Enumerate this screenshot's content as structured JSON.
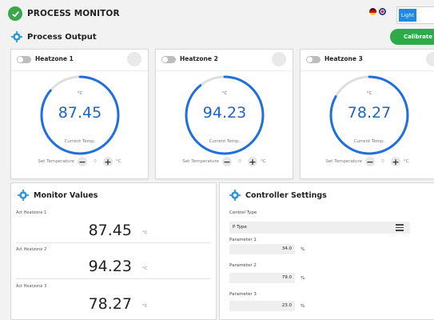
{
  "header": {
    "app_title": "PROCESS MONITOR",
    "section_title": "Process Output",
    "theme_light_label": "Light",
    "calibrate_label": "Calibrate",
    "flags": [
      "german-flag-icon",
      "uk-flag-icon"
    ]
  },
  "heatzones": [
    {
      "name": "Heatzone 1",
      "unit": "°C",
      "value": "87.45",
      "current_label": "Current Temp.",
      "set_label": "Set Temperature",
      "set_value": "0",
      "set_unit": "°C",
      "gauge_fraction": 0.86
    },
    {
      "name": "Heatzone 2",
      "unit": "°C",
      "value": "94.23",
      "current_label": "Current Temp.",
      "set_label": "Set Temperature",
      "set_value": "0",
      "set_unit": "°C",
      "gauge_fraction": 0.89
    },
    {
      "name": "Heatzone 3",
      "unit": "°C",
      "value": "78.27",
      "current_label": "Current Temp.",
      "set_label": "Set Temperature",
      "set_value": "0",
      "set_unit": "°C",
      "gauge_fraction": 0.83
    }
  ],
  "monitor": {
    "title": "Monitor Values",
    "items": [
      {
        "label": "Act Heatzone 1",
        "value": "87.45",
        "unit": "°C"
      },
      {
        "label": "Act Heatzone 2",
        "value": "94.23",
        "unit": "°C"
      },
      {
        "label": "Act Heatzone 3",
        "value": "78.27",
        "unit": "°C"
      }
    ]
  },
  "controller": {
    "title": "Controller Settings",
    "control_type_label": "Control Type",
    "control_type_value": "P Type",
    "params": [
      {
        "label": "Parameter 1",
        "value": "34.0",
        "unit": "%"
      },
      {
        "label": "Parameter 2",
        "value": "79.0",
        "unit": "%"
      },
      {
        "label": "Parameter 3",
        "value": "23.0",
        "unit": "%"
      }
    ]
  },
  "colors": {
    "accent": "#1e88e5",
    "success": "#2dab46",
    "gauge": "#1e6fe0"
  }
}
